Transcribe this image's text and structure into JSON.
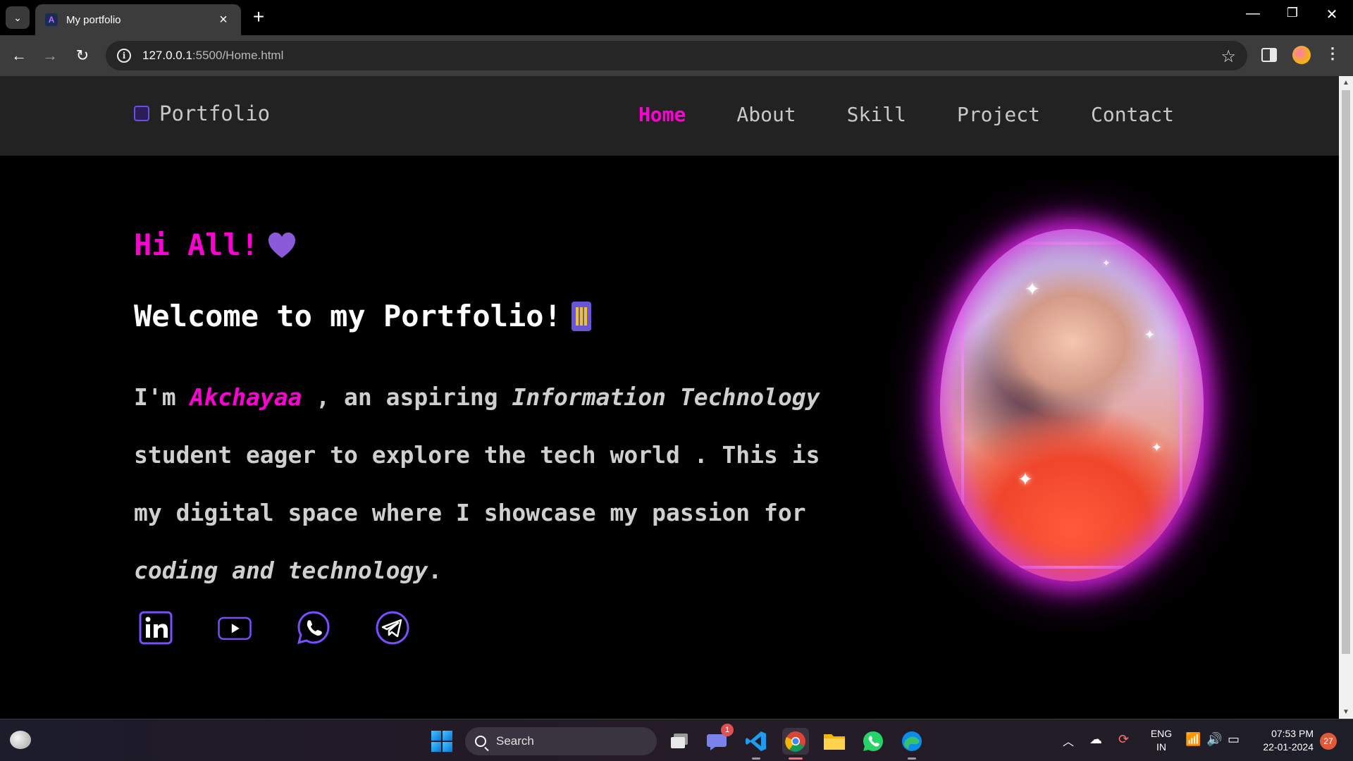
{
  "browser": {
    "tab_title": "My portfolio",
    "url_host": "127.0.0.1",
    "url_rest": ":5500/Home.html"
  },
  "site": {
    "logo_text": "Portfolio",
    "nav": [
      "Home",
      "About",
      "Skill",
      "Project",
      "Contact"
    ],
    "active_nav": "Home",
    "greeting": "Hi All!",
    "welcome": "Welcome to my Portfolio!",
    "intro": {
      "p1": "I'm ",
      "name": "Akchayaa",
      "p2": " , an aspiring ",
      "field": "Information Technology",
      "p3": " student eager to explore the tech world . This is my digital space where I showcase my passion for ",
      "tail": "coding and technology",
      "end": "."
    },
    "socials": [
      "linkedin-icon",
      "youtube-icon",
      "whatsapp-icon",
      "telegram-icon"
    ],
    "colors": {
      "accent": "#ff00d4",
      "header_bg": "#222222",
      "icon_stroke": "#7a4dff"
    }
  },
  "taskbar": {
    "search_label": "Search",
    "chat_badge": "1",
    "lang_line1": "ENG",
    "lang_line2": "IN",
    "time": "07:53 PM",
    "date": "22-01-2024",
    "notifications": "27"
  }
}
